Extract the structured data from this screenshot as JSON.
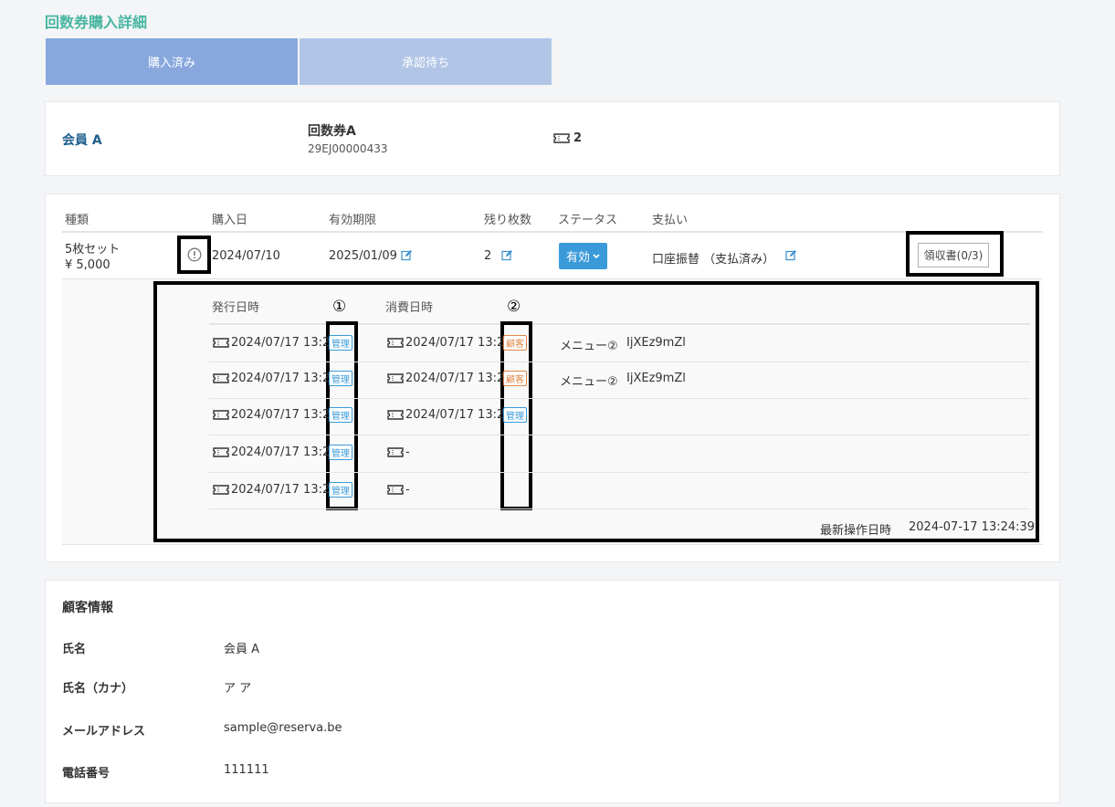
{
  "page_title": "回数券購入詳細",
  "tabs": [
    {
      "label": "購入済み"
    },
    {
      "label": "承認待ち"
    }
  ],
  "summary": {
    "member": "会員 A",
    "ticket_name": "回数券A",
    "ticket_code": "29EJ00000433",
    "ticket_count": "2"
  },
  "table": {
    "headers": [
      "種類",
      "購入日",
      "有効期限",
      "残り枚数",
      "ステータス",
      "支払い"
    ],
    "row": {
      "type": "5枚セット",
      "price": "¥ 5,000",
      "purchase_date": "2024/07/10",
      "expiry": "2025/01/09",
      "remaining": "2",
      "status": "有効",
      "payment": "口座振替 （支払済み）",
      "receipt": "領収書(0/3)"
    }
  },
  "detail": {
    "headers": [
      "発行日時",
      "消費日時"
    ],
    "markers": [
      "①",
      "②"
    ],
    "rows": [
      {
        "issued": "2024/07/17 13:24",
        "issued_tag": "管理",
        "consumed": "2024/07/17 13:24",
        "consumed_tag": "顧客",
        "menu": "メニュー②",
        "code": "IjXEz9mZl"
      },
      {
        "issued": "2024/07/17 13:24",
        "issued_tag": "管理",
        "consumed": "2024/07/17 13:24",
        "consumed_tag": "顧客",
        "menu": "メニュー②",
        "code": "IjXEz9mZl"
      },
      {
        "issued": "2024/07/17 13:24",
        "issued_tag": "管理",
        "consumed": "2024/07/17 13:24",
        "consumed_tag": "管理",
        "menu": "",
        "code": ""
      },
      {
        "issued": "2024/07/17 13:24",
        "issued_tag": "管理",
        "consumed": "-",
        "consumed_tag": "",
        "menu": "",
        "code": ""
      },
      {
        "issued": "2024/07/17 13:24",
        "issued_tag": "管理",
        "consumed": "-",
        "consumed_tag": "",
        "menu": "",
        "code": ""
      }
    ],
    "last_op_label": "最新操作日時",
    "last_op_value": "2024-07-17 13:24:39"
  },
  "customer": {
    "heading": "顧客情報",
    "fields": [
      {
        "label": "氏名",
        "value": "会員 A"
      },
      {
        "label": "氏名（カナ）",
        "value": "ア ア"
      },
      {
        "label": "メールアドレス",
        "value": "sample@reserva.be"
      },
      {
        "label": "電話番号",
        "value": "111111"
      }
    ]
  },
  "colors": {
    "accent": "#47b5a0",
    "tab_active": "#88a8dd",
    "tab_inactive": "#b1c5e6",
    "status": "#3a9ad9",
    "admin_tag": "#3a9ad9",
    "customer_tag": "#e0884a"
  },
  "icons": [
    "ticket-icon",
    "exclamation-circle-icon",
    "edit-icon",
    "chevron-down-icon"
  ]
}
